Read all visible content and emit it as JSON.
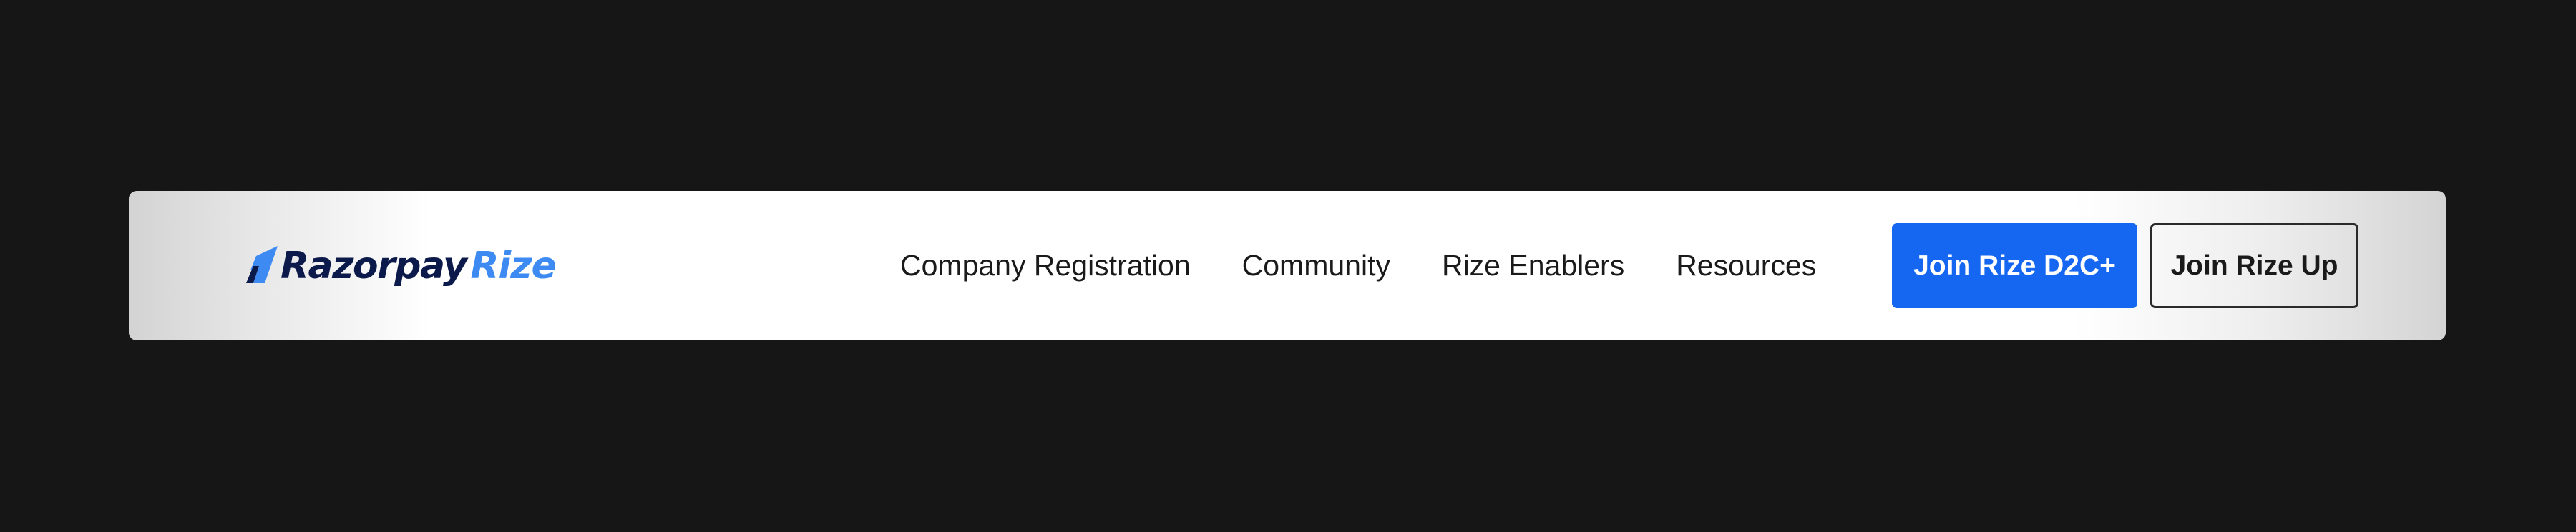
{
  "header": {
    "logo": {
      "brand": "Razorpay",
      "product": "Rize",
      "brand_color": "#0b1a4a",
      "accent_color": "#3d8bf2",
      "icon": "razorpay-logo-icon"
    },
    "nav": [
      {
        "label": "Company Registration"
      },
      {
        "label": "Community"
      },
      {
        "label": "Rize Enablers"
      },
      {
        "label": "Resources"
      }
    ],
    "cta_primary": {
      "label": "Join Rize D2C+",
      "color": "#1566f0"
    },
    "cta_secondary": {
      "label": "Join Rize Up"
    }
  },
  "colors": {
    "page_background": "#161616",
    "navbar_background": "#ffffff"
  }
}
